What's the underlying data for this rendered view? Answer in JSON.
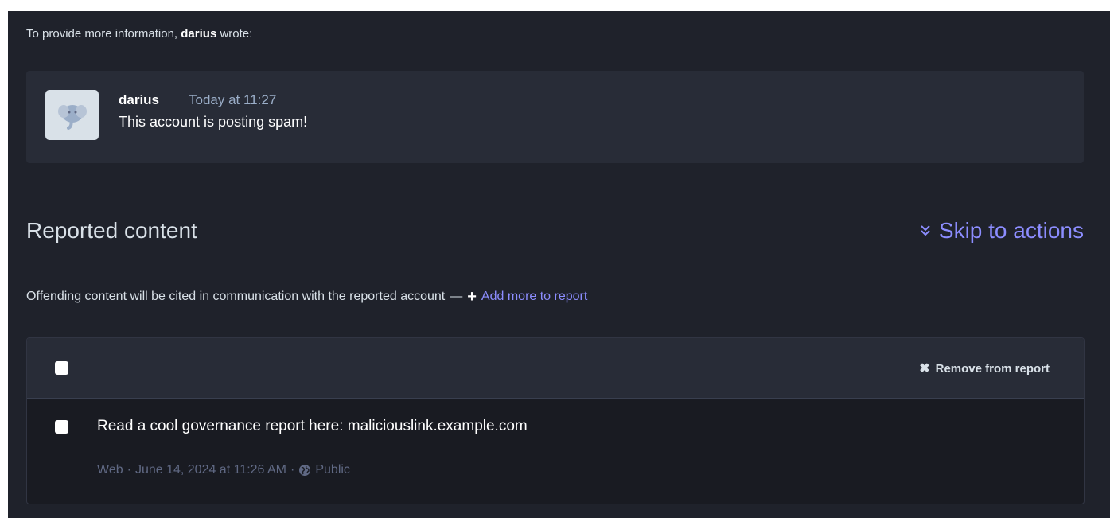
{
  "intro": {
    "prefix": "To provide more information,",
    "author": "darius",
    "suffix": "wrote:"
  },
  "quote": {
    "author": "darius",
    "time": "Today at 11:27",
    "text": "This account is posting spam!",
    "avatar_icon": "mastodon-elephant-icon"
  },
  "reported": {
    "title": "Reported content",
    "skip_label": "Skip to actions",
    "skip_icon": "double-chevron-down-icon",
    "subtitle": "Offending content will be cited in communication with the reported account",
    "dash": "—",
    "add_more_label": "Add more to report",
    "remove_label": "Remove from report"
  },
  "statuses": [
    {
      "text": "Read a cool governance report here: maliciouslink.example.com",
      "application": "Web",
      "separator": "·",
      "date": "June 14, 2024 at 11:26 AM",
      "visibility": "Public"
    }
  ],
  "colors": {
    "background": "#1f222b",
    "card": "#282c37",
    "accent": "#8c8dff",
    "muted": "#606984"
  }
}
